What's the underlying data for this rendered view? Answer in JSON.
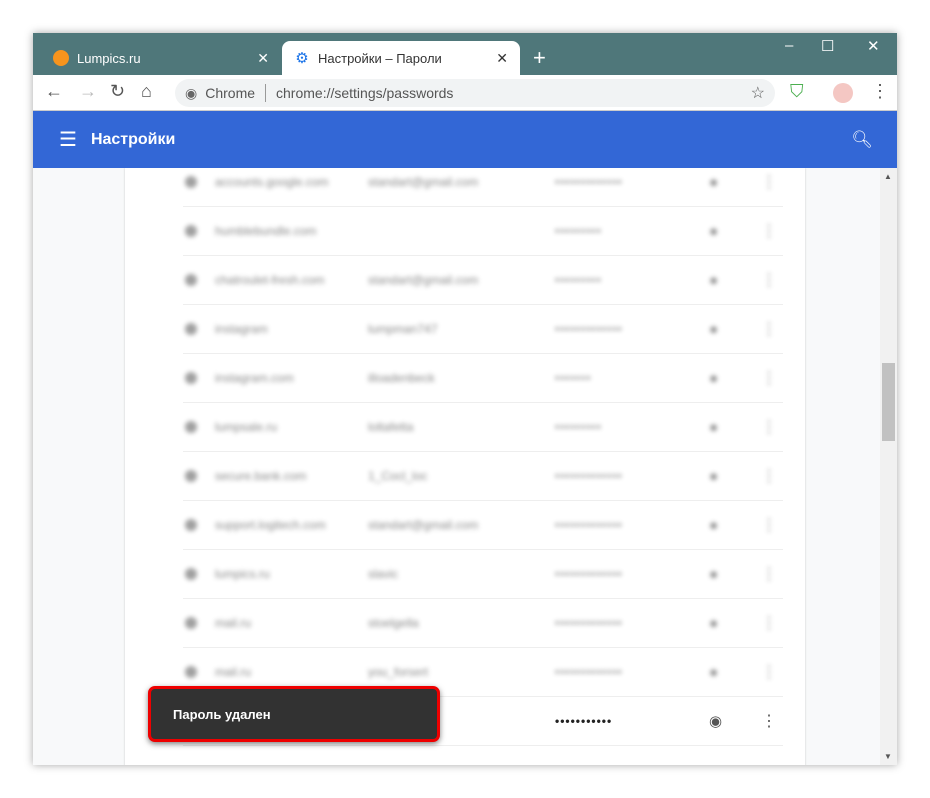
{
  "tabs": [
    {
      "label": "Lumpics.ru",
      "icon": "orange-icon"
    },
    {
      "label": "Настройки – Пароли",
      "icon": "gear-icon"
    }
  ],
  "window": {
    "minimize": "–",
    "maximize": "☐",
    "close": "✕"
  },
  "omnibox": {
    "origin": "Chrome",
    "url": "chrome://settings/passwords"
  },
  "header": {
    "title": "Настройки",
    "color": "#3367d6"
  },
  "rows": [
    {
      "site": "accounts.google.com",
      "user": "standart@gmail.com",
      "pw": "•••••••••••••"
    },
    {
      "site": "humblebundle.com",
      "user": "",
      "pw": "•••••••••"
    },
    {
      "site": "chatroulet-fresh.com",
      "user": "standart@gmail.com",
      "pw": "•••••••••"
    },
    {
      "site": "instagram",
      "user": "lumpman747",
      "pw": "•••••••••••••"
    },
    {
      "site": "instagram.com",
      "user": "illoadenbeck",
      "pw": "•••••••"
    },
    {
      "site": "lumpsale.ru",
      "user": "loltafetta",
      "pw": "•••••••••"
    },
    {
      "site": "secure.bank.com",
      "user": "1_Cocl_loc",
      "pw": "•••••••••••••"
    },
    {
      "site": "support.logitech.com",
      "user": "standart@gmail.com",
      "pw": "•••••••••••••"
    },
    {
      "site": "lumpics.ru",
      "user": "slavic",
      "pw": "•••••••••••••"
    },
    {
      "site": "mail.ru",
      "user": "stoelgella",
      "pw": "•••••••••••••"
    },
    {
      "site": "mail.ru",
      "user": "you_forsert",
      "pw": "•••••••••••••"
    }
  ],
  "deleted_row": {
    "pw": "•••••••••••"
  },
  "toast": {
    "message": "Пароль удален"
  }
}
